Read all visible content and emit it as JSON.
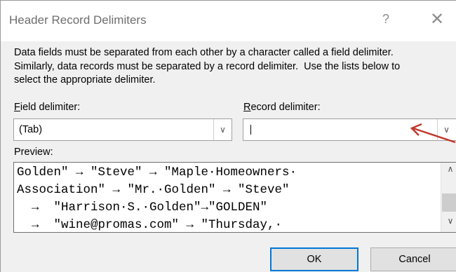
{
  "dialog": {
    "title": "Header Record Delimiters",
    "help_label": "?",
    "close_label": "✕",
    "description": "Data fields must be separated from each other by a character called a field delimiter.\nSimilarly, data records must be separated by a record delimiter.  Use the lists below to\nselect the appropriate delimiter."
  },
  "field_delimiter": {
    "label_mnemonic": "F",
    "label_rest": "ield delimiter:",
    "value": "(Tab)"
  },
  "record_delimiter": {
    "label_mnemonic": "R",
    "label_rest": "ecord delimiter:",
    "value": ""
  },
  "preview": {
    "label": "Preview:",
    "lines": [
      "Golden\" → \"Steve\" → \"Maple·Homeowners·",
      "Association\" → \"Mr.·Golden\" → \"Steve\"",
      "  →  \"Harrison·S.·Golden\"→\"GOLDEN\"",
      "  →  \"wine@promas.com\" → \"Thursday,·"
    ]
  },
  "buttons": {
    "ok": "OK",
    "cancel": "Cancel"
  },
  "colors": {
    "annotation_arrow": "#c0392b",
    "ok_border": "#0078d7"
  },
  "icons": {
    "combo_arrow": "chevron-down-icon",
    "scroll_up": "chevron-up-icon",
    "scroll_down": "chevron-down-icon"
  }
}
